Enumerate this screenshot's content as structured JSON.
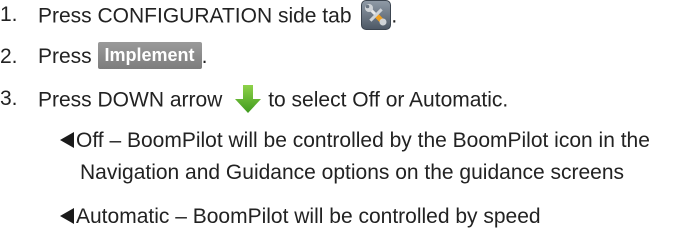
{
  "steps": [
    {
      "number": "1.",
      "text_before": "Press CONFIGURATION side tab",
      "text_after": "."
    },
    {
      "number": "2.",
      "text_before": "Press",
      "button_label": "Implement",
      "text_after": "."
    },
    {
      "number": "3.",
      "text_before": "Press DOWN arrow",
      "text_after": "to select Off or Automatic."
    }
  ],
  "options": [
    {
      "line1": "Off – BoomPilot will be controlled by the BoomPilot icon in the",
      "line2": "Navigation and Guidance options on the guidance screens"
    },
    {
      "line1": "Automatic – BoomPilot will be controlled by speed"
    }
  ],
  "icons": {
    "config": "wrench-screwdriver-icon",
    "arrow": "green-down-arrow-icon",
    "bullet": "left-triangle-icon"
  },
  "colors": {
    "text": "#222222",
    "button_bg": "#8a8a8a",
    "arrow_green": "#5cb82e"
  }
}
